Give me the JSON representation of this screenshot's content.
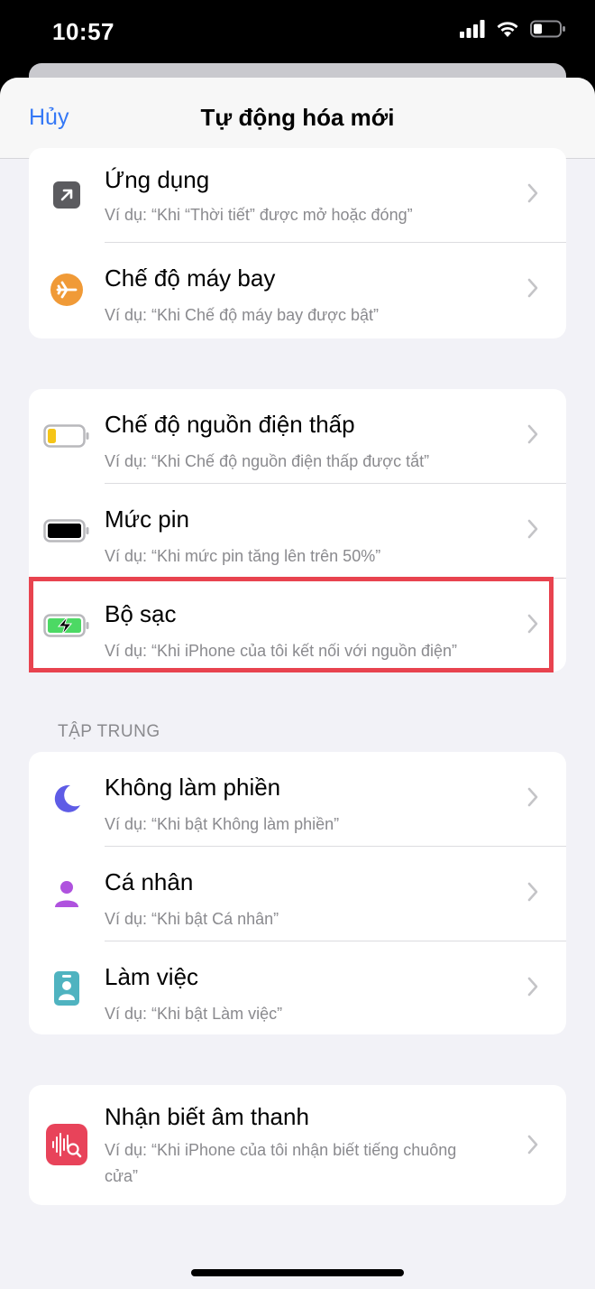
{
  "status_bar": {
    "time": "10:57"
  },
  "nav": {
    "cancel_label": "Hủy",
    "title": "Tự động hóa mới"
  },
  "groups": [
    {
      "rows": [
        {
          "title": "Ứng dụng",
          "subtitle": "Ví dụ: “Khi “Thời tiết” được mở hoặc đóng”",
          "icon": "app-arrow-icon"
        },
        {
          "title": "Chế độ máy bay",
          "subtitle": "Ví dụ: “Khi Chế độ máy bay được bật”",
          "icon": "airplane-icon"
        }
      ]
    },
    {
      "rows": [
        {
          "title": "Chế độ nguồn điện thấp",
          "subtitle": "Ví dụ: “Khi Chế độ nguồn điện thấp được tắt”",
          "icon": "low-power-battery-icon"
        },
        {
          "title": "Mức pin",
          "subtitle": "Ví dụ: “Khi mức pin tăng lên trên 50%”",
          "icon": "battery-level-icon"
        },
        {
          "title": "Bộ sạc",
          "subtitle": "Ví dụ: “Khi iPhone của tôi kết nối với nguồn điện”",
          "icon": "charging-battery-icon"
        }
      ]
    },
    {
      "header": "TẬP TRUNG",
      "rows": [
        {
          "title": "Không làm phiền",
          "subtitle": "Ví dụ: “Khi bật Không làm phiền”",
          "icon": "moon-icon"
        },
        {
          "title": "Cá nhân",
          "subtitle": "Ví dụ: “Khi bật Cá nhân”",
          "icon": "person-icon"
        },
        {
          "title": "Làm việc",
          "subtitle": "Ví dụ: “Khi bật Làm việc”",
          "icon": "work-badge-icon"
        }
      ]
    },
    {
      "rows": [
        {
          "title": "Nhận biết âm thanh",
          "subtitle": "Ví dụ: “Khi iPhone của tôi nhận biết tiếng chuông cửa”",
          "icon": "sound-recognition-icon"
        }
      ]
    }
  ],
  "colors": {
    "accent": "#3478f6",
    "airplane": "#f09a37",
    "focus_moon": "#5e5ce6",
    "focus_person": "#af52de",
    "focus_work": "#4fb3c0",
    "sound": "#e8435a",
    "highlight": "#e8434f"
  }
}
